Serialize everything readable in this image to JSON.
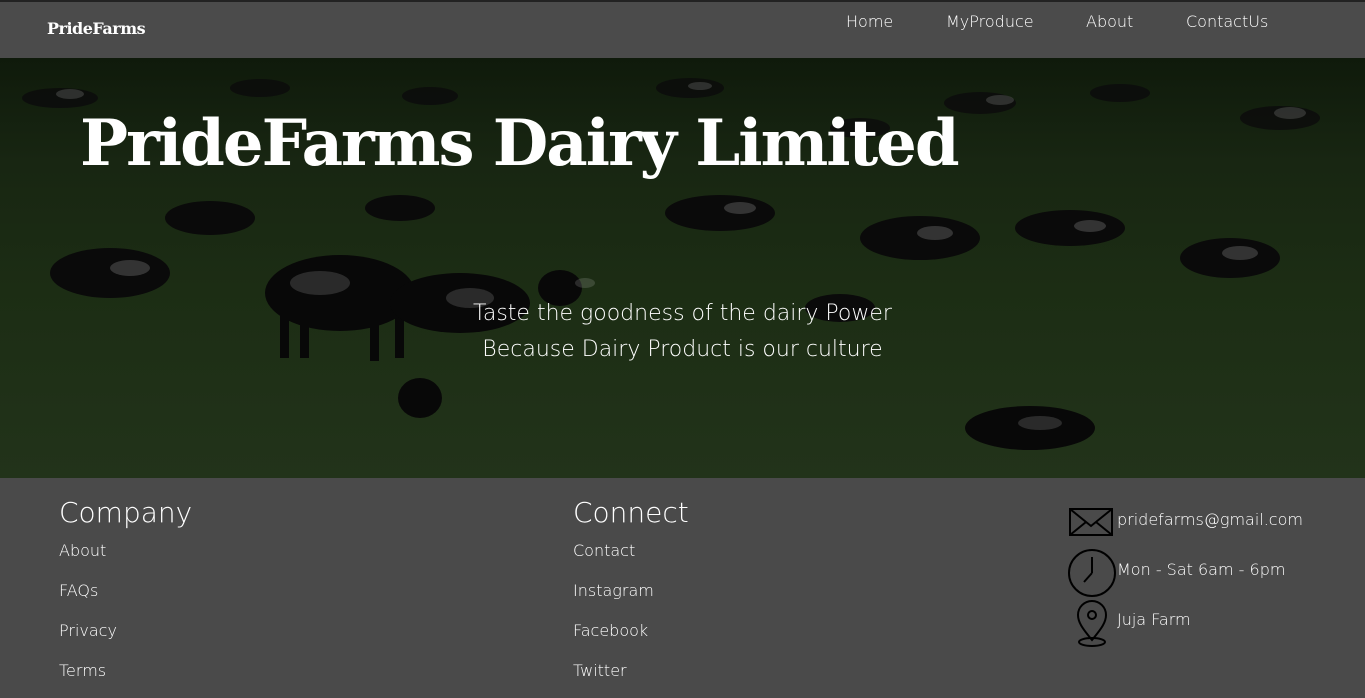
{
  "nav": {
    "brand": "PrideFarms",
    "links": [
      "Home",
      "MyProduce",
      "About",
      "ContactUs"
    ]
  },
  "hero": {
    "title": "PrideFarms Dairy Limited",
    "tagline_line1": "Taste the goodness of the dairy Power",
    "tagline_line2": "Because Dairy Product is our culture"
  },
  "footer": {
    "company": {
      "title": "Company",
      "links": [
        "About",
        "FAQs",
        "Privacy",
        "Terms"
      ]
    },
    "connect": {
      "title": "Connect",
      "links": [
        "Contact",
        "Instagram",
        "Facebook",
        "Twitter"
      ]
    },
    "contact": {
      "email": "pridefarms@gmail.com",
      "hours": "Mon - Sat 6am - 6pm",
      "location": "Juja Farm"
    }
  },
  "icons": [
    "envelope-icon",
    "clock-icon",
    "location-pin-icon"
  ],
  "colors": {
    "nav_bg": "#4b4b4b",
    "footer_bg": "#4a4a4a",
    "text": "#ffffff",
    "hero_overlay": "#1c2d14"
  }
}
